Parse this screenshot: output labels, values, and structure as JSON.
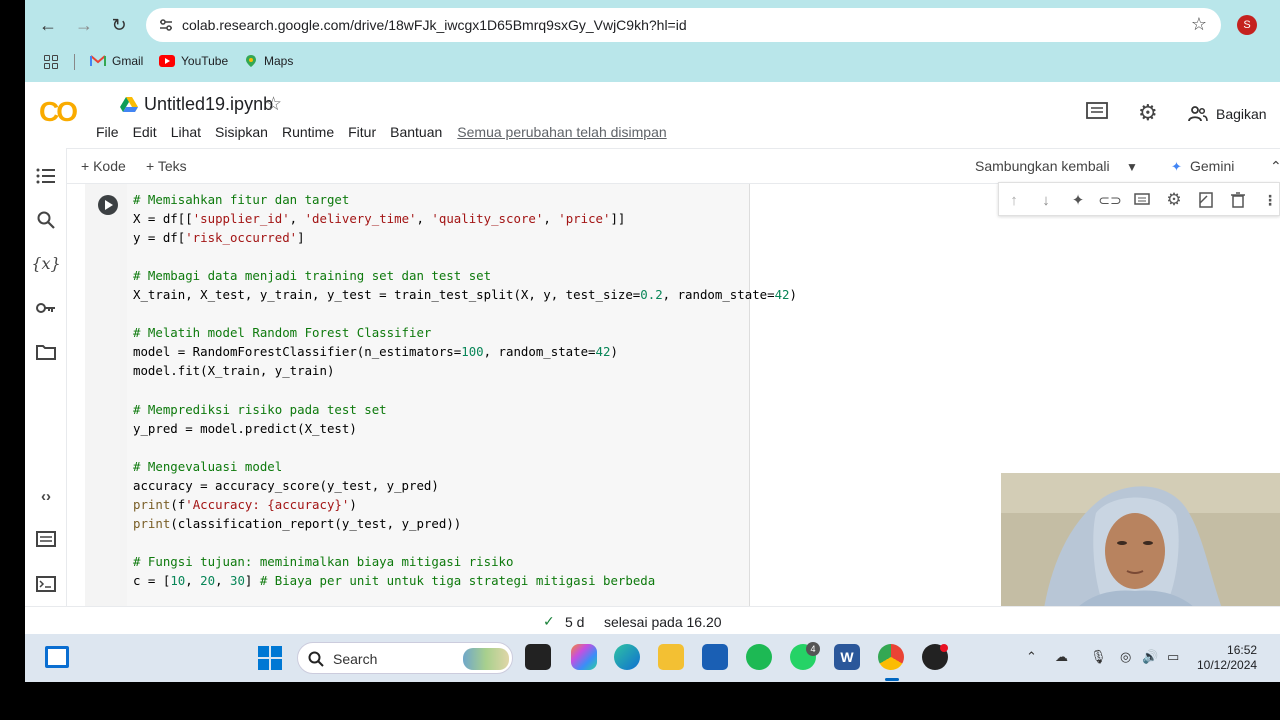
{
  "browser": {
    "url": "colab.research.google.com/drive/18wFJk_iwcgx1D65Bmrq9sxGy_VwjC9kh?hl=id",
    "profile_initial": "S",
    "bookmarks": [
      {
        "label": "Gmail",
        "icon": "gmail-icon"
      },
      {
        "label": "YouTube",
        "icon": "youtube-icon"
      },
      {
        "label": "Maps",
        "icon": "maps-icon"
      }
    ]
  },
  "colab": {
    "logo": "CO",
    "title": "Untitled19.ipynb",
    "menu": [
      "File",
      "Edit",
      "Lihat",
      "Sisipkan",
      "Runtime",
      "Fitur",
      "Bantuan"
    ],
    "saved_status": "Semua perubahan telah disimpan",
    "share_label": "Bagikan"
  },
  "toolbar": {
    "add_code": "+ Kode",
    "add_text": "+ Teks",
    "reconnect": "Sambungkan kembali",
    "gemini": "Gemini"
  },
  "cell": {
    "lines": [
      "# Memisahkan fitur dan target",
      "X = df[['supplier_id', 'delivery_time', 'quality_score', 'price']]",
      "y = df['risk_occurred']",
      "",
      "# Membagi data menjadi training set dan test set",
      "X_train, X_test, y_train, y_test = train_test_split(X, y, test_size=0.2, random_state=42)",
      "",
      "# Melatih model Random Forest Classifier",
      "model = RandomForestClassifier(n_estimators=100, random_state=42)",
      "model.fit(X_train, y_train)",
      "",
      "# Memprediksi risiko pada test set",
      "y_pred = model.predict(X_test)",
      "",
      "# Mengevaluasi model",
      "accuracy = accuracy_score(y_test, y_pred)",
      "print(f'Accuracy: {accuracy}')",
      "print(classification_report(y_test, y_pred))",
      "",
      "# Fungsi tujuan: meminimalkan biaya mitigasi risiko",
      "c = [10, 20, 30] # Biaya per unit untuk tiga strategi mitigasi berbeda"
    ]
  },
  "status": {
    "duration": "5 d",
    "text": "selesai pada 16.20"
  },
  "taskbar": {
    "search_label": "Search",
    "time": "16:52",
    "date": "10/12/2024",
    "whatsapp_badge": "4"
  }
}
